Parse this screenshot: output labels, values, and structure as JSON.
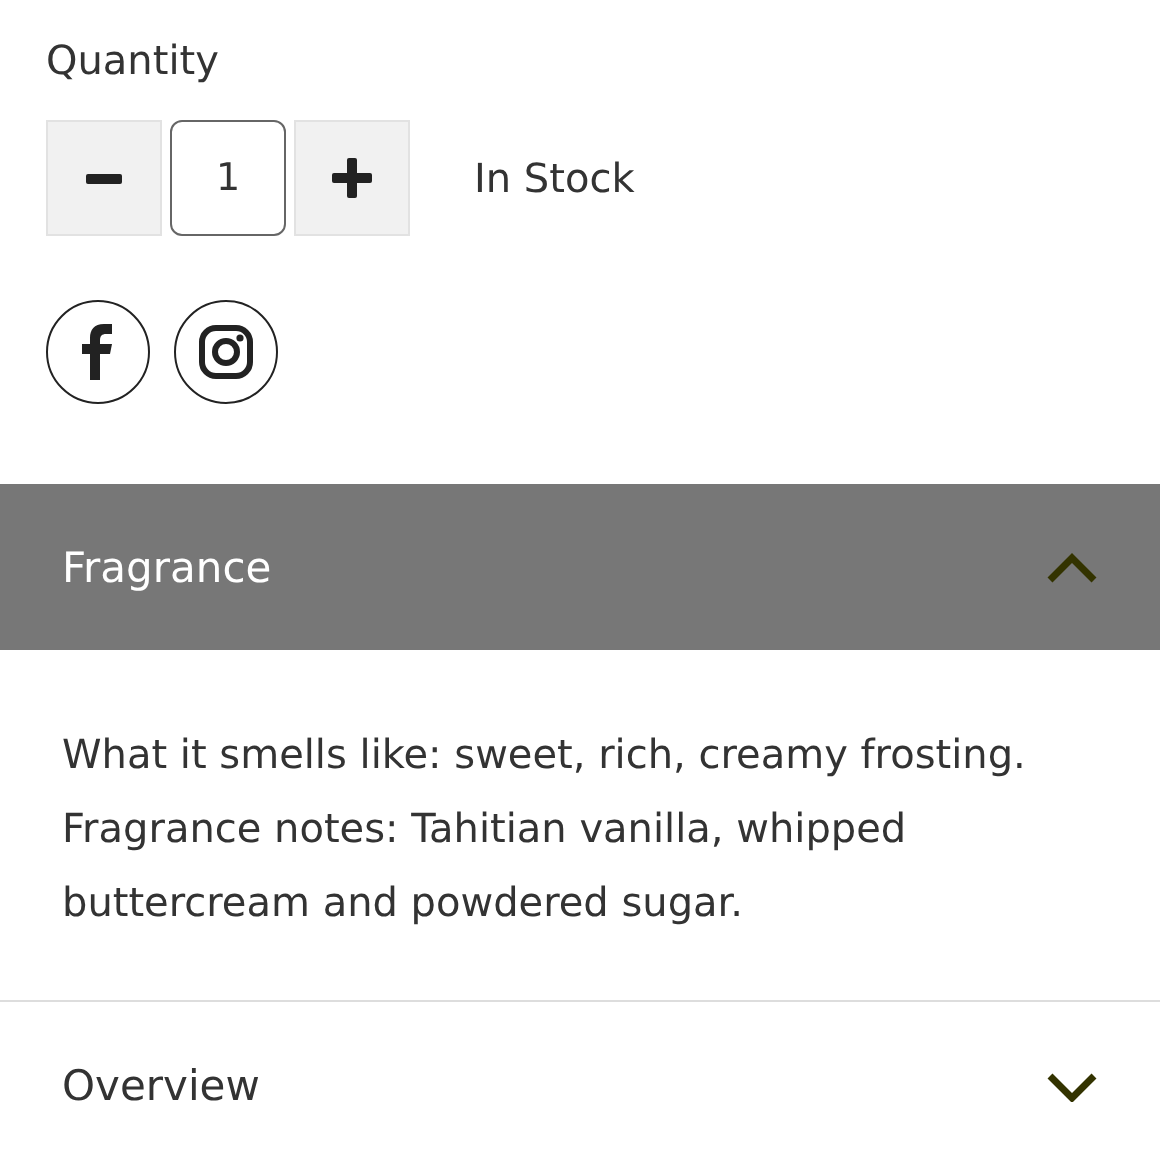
{
  "quantity": {
    "label": "Quantity",
    "value": "1",
    "stock": "In Stock"
  },
  "social": [
    {
      "kind": "facebook"
    },
    {
      "kind": "instagram"
    }
  ],
  "sections": [
    {
      "title": "Fragrance",
      "expanded": true,
      "body": "What it smells like: sweet, rich, creamy frosting. Fragrance notes: Tahitian vanilla, whipped buttercream and powdered sugar."
    },
    {
      "title": "Overview",
      "expanded": false
    }
  ]
}
